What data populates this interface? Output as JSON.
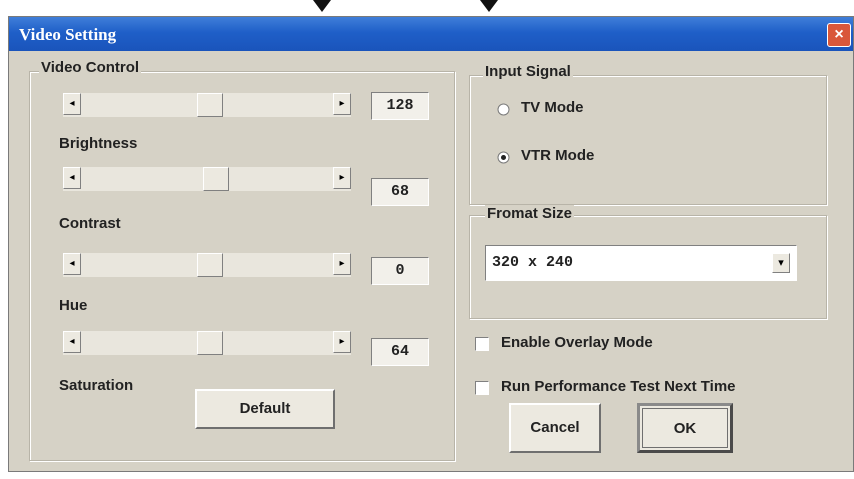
{
  "window": {
    "title": "Video Setting",
    "close_glyph": "×"
  },
  "video_control": {
    "heading": "Video Control",
    "sliders": [
      {
        "label": "",
        "value": "128",
        "level": 0.5
      },
      {
        "label": "Brightness",
        "value": "68",
        "level": 0.53
      },
      {
        "label": "Contrast",
        "value": "0",
        "level": 0.5
      },
      {
        "label": "Hue",
        "value": "64",
        "level": 0.5
      }
    ],
    "saturation_label": "Saturation",
    "default_button": "Default",
    "arrow_left": "◂",
    "arrow_right": "▸"
  },
  "input_signal": {
    "heading": "Input Signal",
    "options": [
      {
        "label": "TV Mode",
        "selected": false
      },
      {
        "label": "VTR Mode",
        "selected": true
      }
    ]
  },
  "format_size": {
    "heading": "Fromat Size",
    "selected": "320 x 240",
    "dropdown_glyph": "▾"
  },
  "checkboxes": [
    {
      "label": "Enable Overlay Mode",
      "checked": false
    },
    {
      "label": "Run Performance Test Next Time",
      "checked": false
    }
  ],
  "buttons": {
    "cancel": "Cancel",
    "ok": "OK"
  },
  "icons": {
    "close": "close-icon",
    "dropdown": "chevron-down-icon",
    "cursor": "arrow-icon"
  },
  "colors": {
    "titlebar": "#1f5fc8",
    "face": "#d6d2c6",
    "close": "#d9573a"
  }
}
